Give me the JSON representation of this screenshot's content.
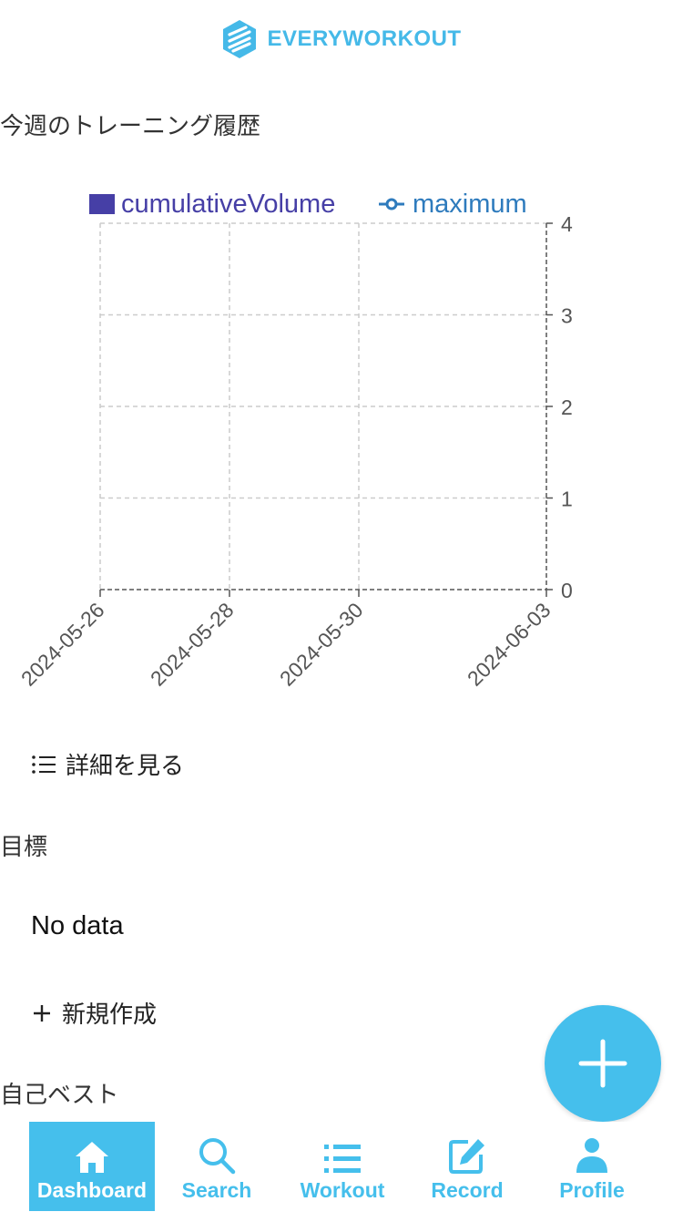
{
  "header": {
    "logo_text": "EVERYWORKOUT"
  },
  "weekly": {
    "title": "今週のトレーニング履歴",
    "details_link": "詳細を見る"
  },
  "chart_data": {
    "type": "bar",
    "series": [
      {
        "name": "cumulativeVolume",
        "type": "bar",
        "color": "#463fa6",
        "values": []
      },
      {
        "name": "maximum",
        "type": "line",
        "color": "#2e7bbd",
        "values": []
      }
    ],
    "x_ticks": [
      "2024-05-26",
      "2024-05-28",
      "2024-05-30",
      "2024-06-03"
    ],
    "y_ticks": [
      "0",
      "1",
      "2",
      "3",
      "4"
    ],
    "ylim": [
      0,
      4
    ],
    "y_axis_side": "right",
    "grid": true,
    "legend_position": "top"
  },
  "goals": {
    "title": "目標",
    "empty_text": "No data",
    "new_label": "新規作成"
  },
  "records": {
    "title": "自己ベスト"
  },
  "colors": {
    "accent": "#45bfec",
    "bar_series": "#463fa6",
    "line_series": "#2e7bbd"
  },
  "nav": [
    {
      "label": "Dashboard",
      "icon": "home-icon",
      "active": true
    },
    {
      "label": "Search",
      "icon": "search-icon",
      "active": false
    },
    {
      "label": "Workout",
      "icon": "list-icon",
      "active": false
    },
    {
      "label": "Record",
      "icon": "edit-icon",
      "active": false
    },
    {
      "label": "Profile",
      "icon": "user-icon",
      "active": false
    }
  ]
}
